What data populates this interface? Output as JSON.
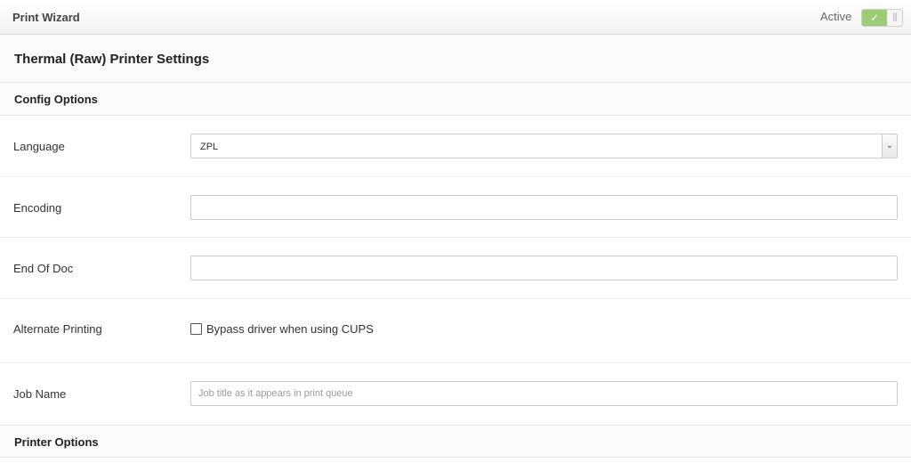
{
  "header": {
    "title": "Print Wizard",
    "active_label": "Active",
    "toggle_check": "✓",
    "toggle_grip": "|||"
  },
  "panel": {
    "title": "Thermal (Raw) Printer Settings"
  },
  "config_options": {
    "title": "Config Options",
    "language": {
      "label": "Language",
      "selected": "ZPL",
      "arrow": "⌄"
    },
    "encoding": {
      "label": "Encoding",
      "value": ""
    },
    "end_of_doc": {
      "label": "End Of Doc",
      "value": ""
    },
    "alternate_printing": {
      "label": "Alternate Printing",
      "checkbox_label": "Bypass driver when using CUPS",
      "checked": false
    },
    "job_name": {
      "label": "Job Name",
      "value": "",
      "placeholder": "Job title as it appears in print queue"
    }
  },
  "printer_options": {
    "title": "Printer Options"
  },
  "colors": {
    "toggle_on": "#9ccc74",
    "border": "#cccccc"
  }
}
